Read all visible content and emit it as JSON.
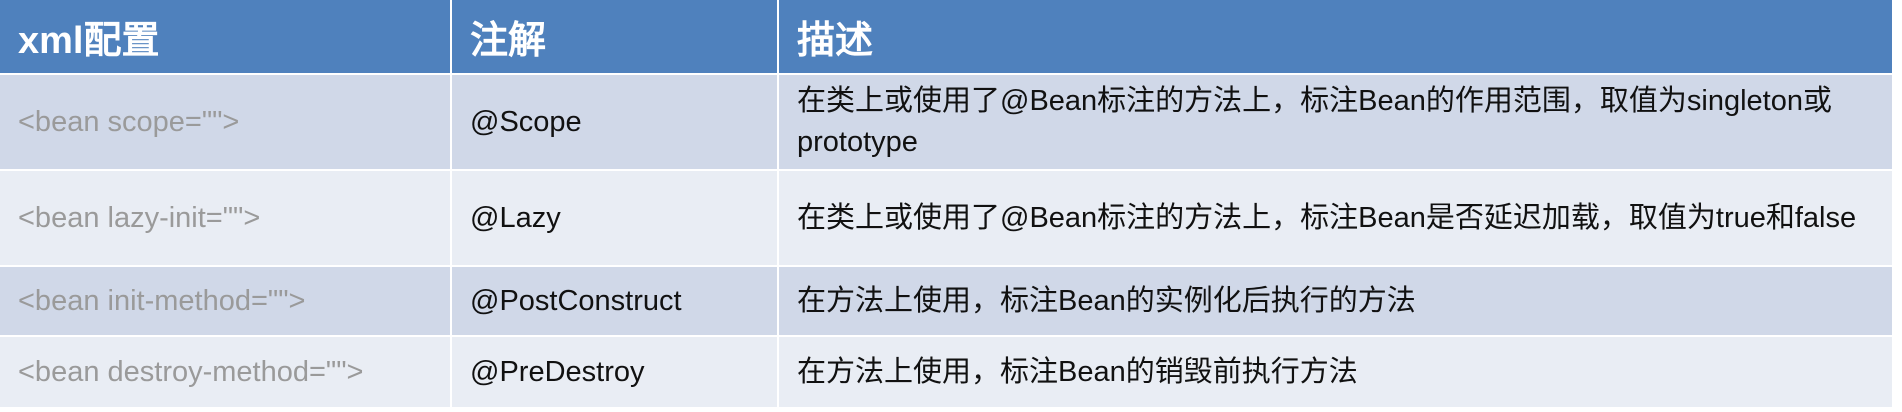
{
  "table": {
    "headers": [
      "xml配置",
      "注解",
      "描述"
    ],
    "rows": [
      {
        "xml": "<bean scope=\"\">",
        "annotation": "@Scope",
        "description": "在类上或使用了@Bean标注的方法上，标注Bean的作用范围，取值为singleton或prototype"
      },
      {
        "xml": "<bean lazy-init=\"\">",
        "annotation": "@Lazy",
        "description": "在类上或使用了@Bean标注的方法上，标注Bean是否延迟加载，取值为true和false"
      },
      {
        "xml": "<bean init-method=\"\">",
        "annotation": "@PostConstruct",
        "description": "在方法上使用，标注Bean的实例化后执行的方法"
      },
      {
        "xml": "<bean destroy-method=\"\">",
        "annotation": "@PreDestroy",
        "description": "在方法上使用，标注Bean的销毁前执行方法"
      }
    ]
  },
  "colors": {
    "header_bg": "#4f81bd",
    "row_dark_bg": "#d0d8e8",
    "row_light_bg": "#e9edf4",
    "xml_text": "#9a9a9a"
  }
}
